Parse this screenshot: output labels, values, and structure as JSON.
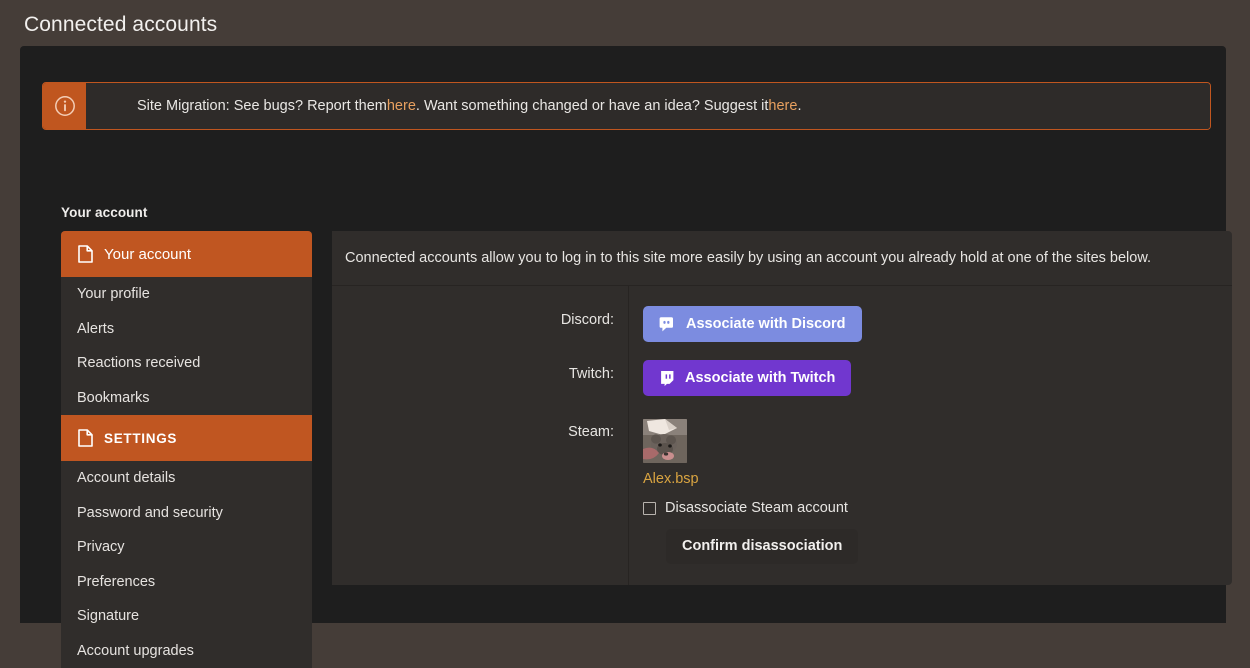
{
  "page": {
    "title": "Connected accounts"
  },
  "notice": {
    "icon": "info-circle-icon",
    "text_part1": "Site Migration: See bugs? Report them ",
    "link1": "here",
    "text_part2": ". Want something changed or have an idea? Suggest it ",
    "link2": "here",
    "text_part3": ".",
    "accent_color": "#c0561f"
  },
  "sidebar": {
    "heading": "Your account",
    "groups": [
      {
        "header": {
          "label": "Your account",
          "icon": "page-document-icon",
          "active": true
        },
        "items": [
          {
            "label": "Your profile"
          },
          {
            "label": "Alerts"
          },
          {
            "label": "Reactions received"
          },
          {
            "label": "Bookmarks"
          }
        ]
      },
      {
        "header": {
          "label": "SETTINGS",
          "icon": "page-document-icon",
          "active": true
        },
        "items": [
          {
            "label": "Account details"
          },
          {
            "label": "Password and security"
          },
          {
            "label": "Privacy"
          },
          {
            "label": "Preferences"
          },
          {
            "label": "Signature"
          },
          {
            "label": "Account upgrades"
          }
        ]
      }
    ]
  },
  "content": {
    "blurb": "Connected accounts allow you to log in to this site more easily by using an account you already hold at one of the sites below.",
    "rows": {
      "discord": {
        "label": "Discord:",
        "button_label": "Associate with Discord",
        "button_icon": "discord-icon",
        "button_color": "#7c8ce0"
      },
      "twitch": {
        "label": "Twitch:",
        "button_label": "Associate with Twitch",
        "button_icon": "twitch-icon",
        "button_color": "#7137cf"
      },
      "steam": {
        "label": "Steam:",
        "avatar_icon": "user-avatar-rat-in-hat",
        "username": "Alex.bsp",
        "username_color": "#d9a441",
        "checkbox_label": "Disassociate Steam account",
        "checkbox_checked": false,
        "confirm_label": "Confirm disassociation"
      }
    }
  }
}
